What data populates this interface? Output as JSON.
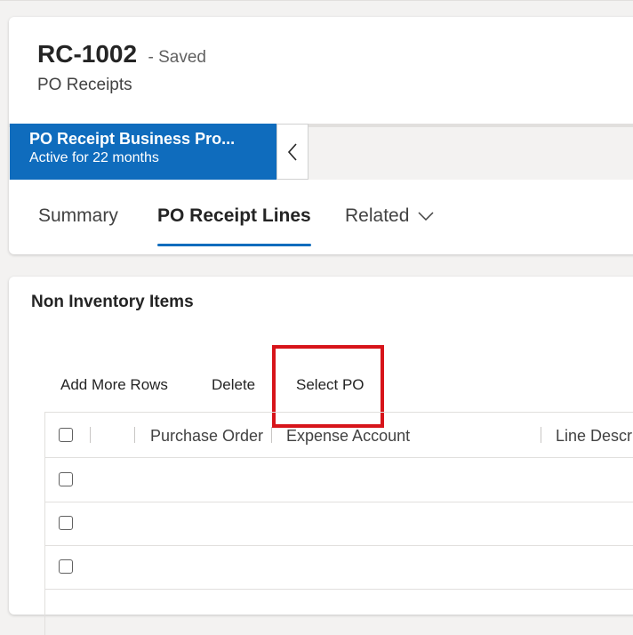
{
  "record": {
    "title": "RC-1002",
    "status": "- Saved",
    "entity": "PO Receipts"
  },
  "bpf": {
    "stage_name": "PO Receipt Business Pro...",
    "stage_duration": "Active for 22 months"
  },
  "tabs": [
    {
      "label": "Summary",
      "active": false
    },
    {
      "label": "PO Receipt Lines",
      "active": true
    },
    {
      "label": "Related",
      "active": false
    }
  ],
  "section": {
    "title": "Non Inventory Items"
  },
  "commands": {
    "add_more_rows": "Add More Rows",
    "delete": "Delete",
    "select_po": "Select PO"
  },
  "grid": {
    "columns": [
      "Purchase Order",
      "Expense Account",
      "Line Description"
    ],
    "row_count": 3
  },
  "colors": {
    "accent": "#0f6cbd",
    "highlight": "#d7141a"
  }
}
